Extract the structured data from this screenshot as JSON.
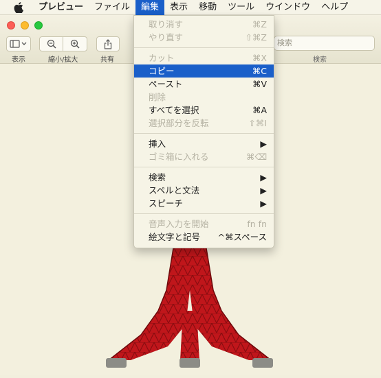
{
  "menubar": {
    "items": [
      "プレビュー",
      "ファイル",
      "編集",
      "表示",
      "移動",
      "ツール",
      "ウインドウ",
      "ヘルプ"
    ],
    "active_index": 2
  },
  "toolbar": {
    "view_label": "表示",
    "zoom_label": "縮小/拡大",
    "share_label": "共有",
    "search_placeholder": "検索",
    "search_label": "検索"
  },
  "edit_menu": {
    "groups": [
      [
        {
          "label": "取り消す",
          "shortcut": "⌘Z",
          "enabled": false
        },
        {
          "label": "やり直す",
          "shortcut": "⇧⌘Z",
          "enabled": false
        }
      ],
      [
        {
          "label": "カット",
          "shortcut": "⌘X",
          "enabled": false
        },
        {
          "label": "コピー",
          "shortcut": "⌘C",
          "enabled": true,
          "highlighted": true
        },
        {
          "label": "ペースト",
          "shortcut": "⌘V",
          "enabled": true
        },
        {
          "label": "削除",
          "shortcut": "",
          "enabled": false
        },
        {
          "label": "すべてを選択",
          "shortcut": "⌘A",
          "enabled": true
        },
        {
          "label": "選択部分を反転",
          "shortcut": "⇧⌘I",
          "enabled": false
        }
      ],
      [
        {
          "label": "挿入",
          "shortcut": "▶",
          "enabled": true
        },
        {
          "label": "ゴミ箱に入れる",
          "shortcut": "⌘⌫",
          "enabled": false
        }
      ],
      [
        {
          "label": "検索",
          "shortcut": "▶",
          "enabled": true
        },
        {
          "label": "スペルと文法",
          "shortcut": "▶",
          "enabled": true
        },
        {
          "label": "スピーチ",
          "shortcut": "▶",
          "enabled": true
        }
      ],
      [
        {
          "label": "音声入力を開始",
          "shortcut": "fn fn",
          "enabled": false
        },
        {
          "label": "絵文字と記号",
          "shortcut": "^⌘スペース",
          "enabled": true
        }
      ]
    ]
  },
  "colors": {
    "menu_highlight": "#1a5fc9",
    "tower_red": "#c0161b",
    "tower_base": "#8c8c86"
  }
}
